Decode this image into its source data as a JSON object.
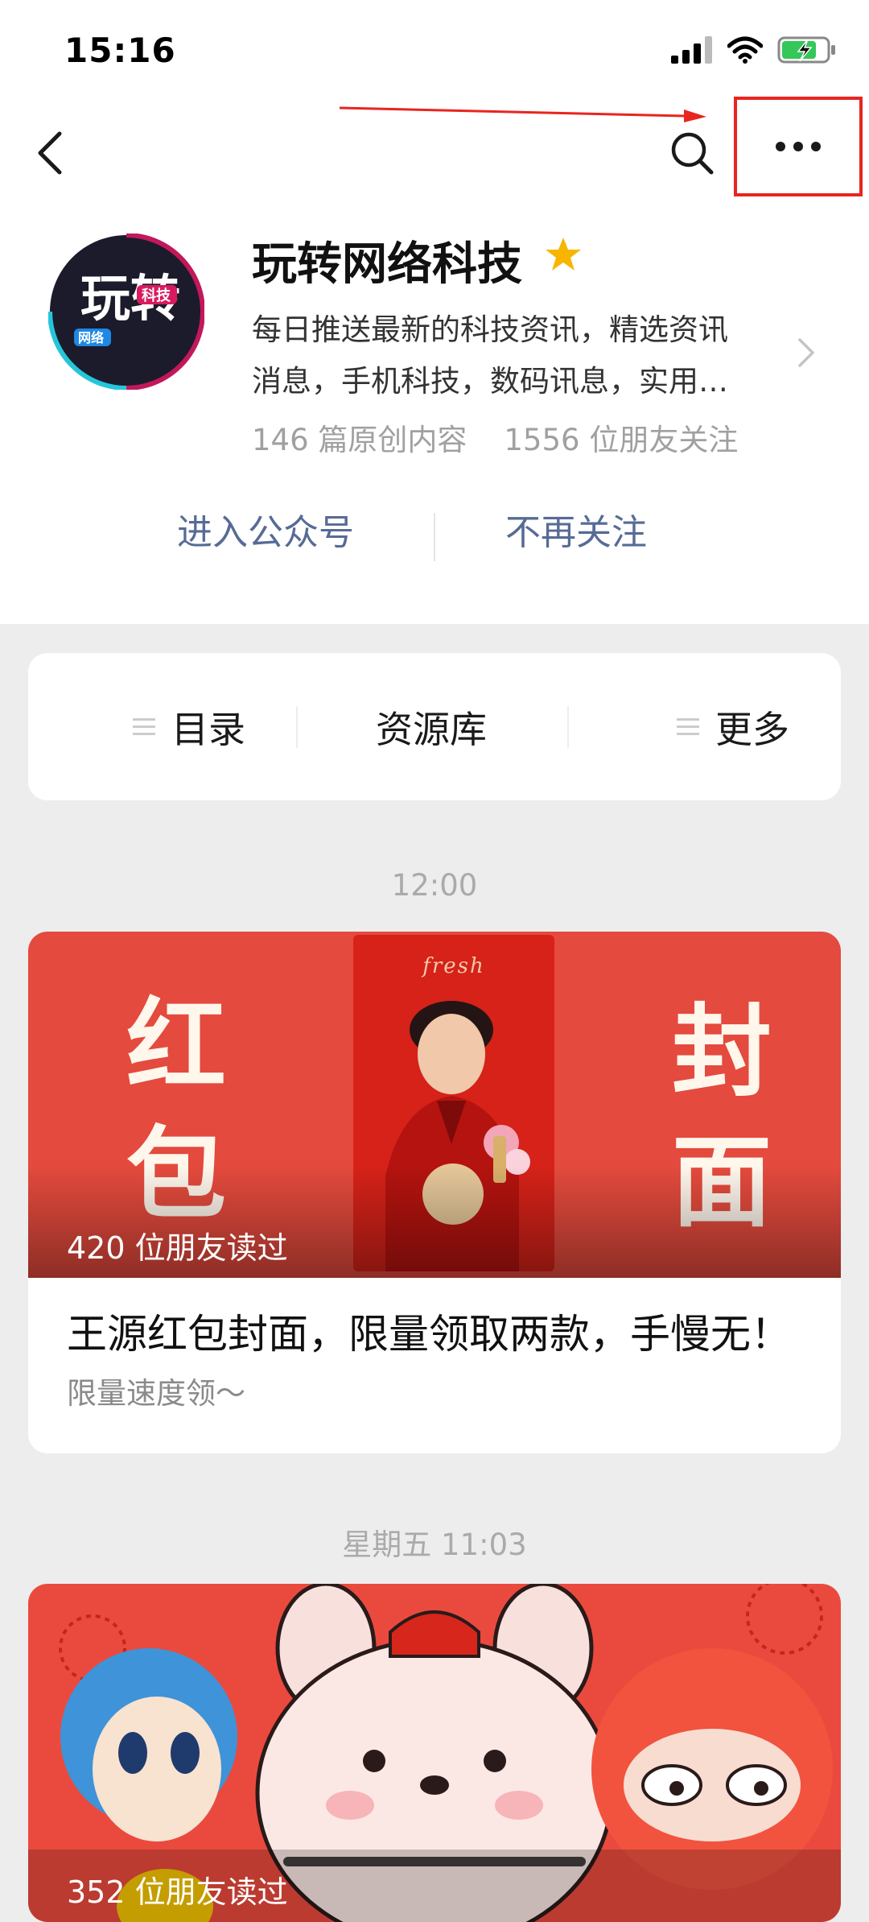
{
  "status_bar": {
    "time": "15:16"
  },
  "account": {
    "name": "玩转网络科技",
    "avatar_text": {
      "main": "玩转",
      "tag1": "科技",
      "tag2": "网络"
    },
    "description_line1": "每日推送最新的科技资讯，精选资讯",
    "description_line2": "消息，手机科技，数码讯息，实用…",
    "original_count": "146 篇原创内容",
    "followers": "1556 位朋友关注"
  },
  "actions": {
    "enter": "进入公众号",
    "unfollow": "不再关注"
  },
  "menu": {
    "directory": "目录",
    "resources": "资源库",
    "more": "更多"
  },
  "feed": [
    {
      "time": "12:00",
      "cover_left": [
        "红",
        "包"
      ],
      "cover_right": [
        "封",
        "面"
      ],
      "cover_brand": "fresh",
      "read_count": "420 位朋友读过",
      "title": "王源红包封面，限量领取两款，手慢无！",
      "subtitle": "限量速度领～"
    },
    {
      "time": "星期五 11:03",
      "read_count": "352 位朋友读过"
    }
  ],
  "colors": {
    "link_blue": "#576b95",
    "highlight_red": "#e8251f",
    "star": "#f7b500",
    "battery_green": "#34c759",
    "cover_red": "#e44a3d"
  },
  "icons": [
    "signal-icon",
    "wifi-icon",
    "battery-icon",
    "back-icon",
    "search-icon",
    "more-icon",
    "star-icon",
    "chevron-right-icon",
    "hamburger-icon"
  ]
}
